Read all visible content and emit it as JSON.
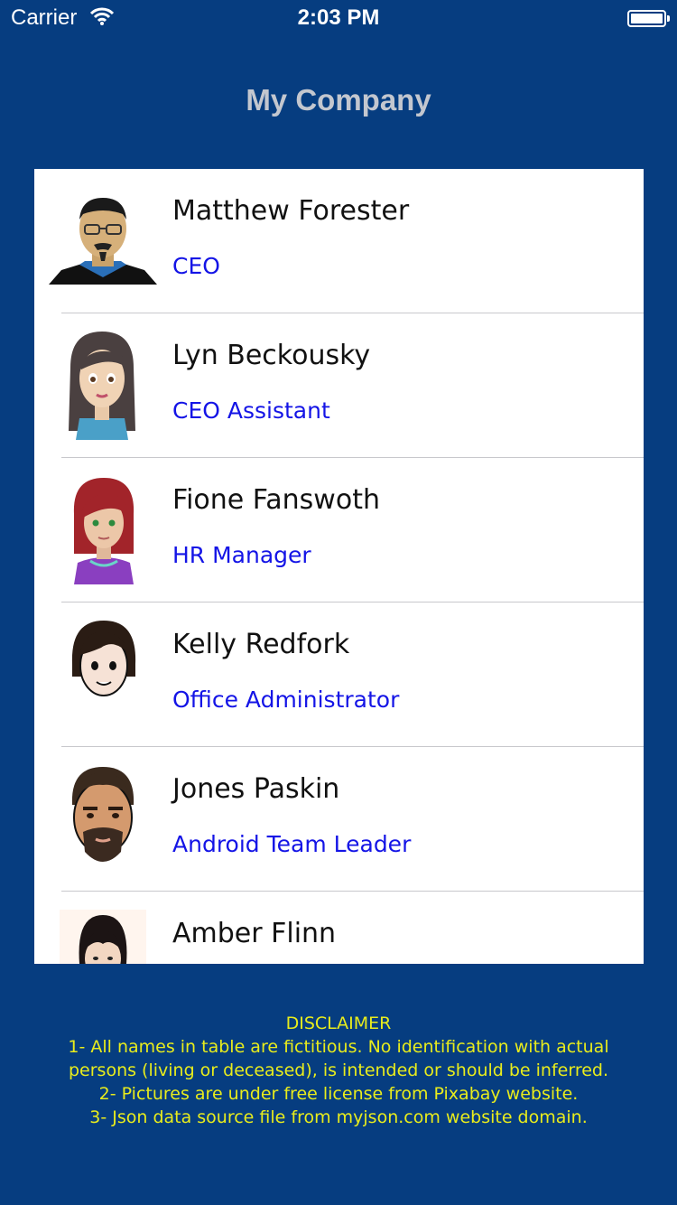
{
  "status_bar": {
    "carrier": "Carrier",
    "time": "2:03 PM"
  },
  "nav": {
    "title": "My Company"
  },
  "employees": [
    {
      "name": "Matthew Forester",
      "role": "CEO",
      "avatar": "man-glasses-goatee-avatar"
    },
    {
      "name": "Lyn Beckousky",
      "role": "CEO Assistant",
      "avatar": "woman-long-hair-avatar"
    },
    {
      "name": "Fione Fanswoth",
      "role": "HR Manager",
      "avatar": "woman-red-hair-avatar"
    },
    {
      "name": "Kelly Redfork",
      "role": "Office Administrator",
      "avatar": "woman-bob-hair-avatar"
    },
    {
      "name": "Jones Paskin",
      "role": "Android Team Leader",
      "avatar": "man-beard-avatar"
    },
    {
      "name": "Amber Flinn",
      "role": "",
      "avatar": "woman-dark-hair-avatar"
    }
  ],
  "disclaimer": {
    "heading": "DISCLAIMER",
    "lines": [
      "1- All names in table are fictitious. No identification with actual",
      "persons (living or deceased), is intended or should be inferred.",
      "2- Pictures are under free license from Pixabay website.",
      "3- Json data source file from myjson.com website domain."
    ]
  },
  "colors": {
    "background": "#063d80",
    "role_text": "#1414e6",
    "disclaimer_text": "#e8ec1c",
    "title_text": "#c3c7cf"
  }
}
